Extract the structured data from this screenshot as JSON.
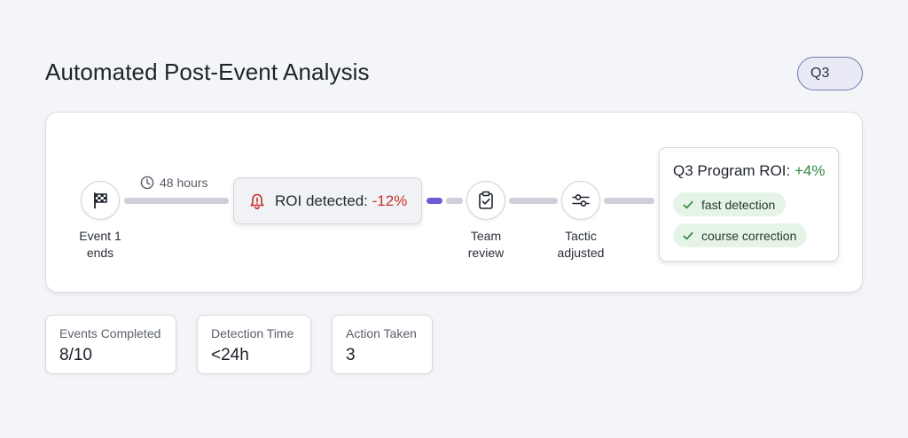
{
  "header": {
    "title": "Automated Post-Event Analysis",
    "period": "Q3"
  },
  "flow": {
    "steps": [
      {
        "label_line1": "Event 1",
        "label_line2": "ends",
        "icon": "checkered-flag-icon"
      },
      {
        "label_line1": "Team",
        "label_line2": "review",
        "icon": "clipboard-check-icon"
      },
      {
        "label_line1": "Tactic",
        "label_line2": "adjusted",
        "icon": "sliders-icon"
      }
    ],
    "duration": {
      "icon": "clock-icon",
      "label": "48 hours"
    },
    "alert": {
      "icon": "bell-icon",
      "label": "ROI detected:",
      "value": "-12%"
    },
    "roi": {
      "label": "Q3 Program ROI:",
      "value": "+4%",
      "chips": [
        {
          "icon": "check-icon",
          "label": "fast detection"
        },
        {
          "icon": "check-icon",
          "label": "course correction"
        }
      ]
    }
  },
  "metrics": [
    {
      "label": "Events Completed",
      "value": "8/10"
    },
    {
      "label": "Detection Time",
      "value": "<24h"
    },
    {
      "label": "Action Taken",
      "value": "3"
    }
  ],
  "colors": {
    "accent": "#6a5cd6",
    "negative": "#c9302c",
    "positive": "#2f8a3e",
    "chip_bg": "#e6f4e8"
  }
}
